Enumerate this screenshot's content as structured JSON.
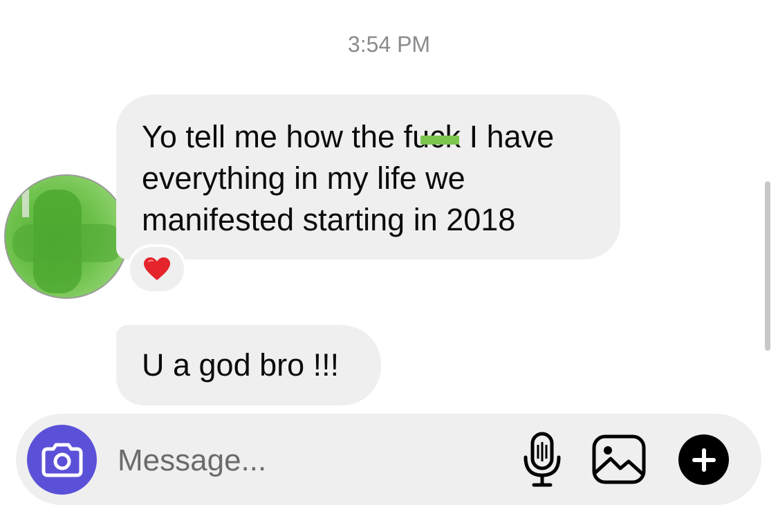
{
  "conversation": {
    "timestamp": "3:54 PM",
    "messages": [
      {
        "sender": "contact",
        "text_lines": [
          {
            "before": "Yo tell me how the ",
            "censored": "fuck",
            "after": " I have"
          },
          {
            "text": "everything in my life we"
          },
          {
            "text": "manifested starting in 2018"
          }
        ],
        "reaction": {
          "emoji": "heart",
          "color": "#e5242b"
        }
      },
      {
        "sender": "contact",
        "text": "U a god bro !!!"
      }
    ]
  },
  "composer": {
    "placeholder": "Message...",
    "camera_icon": "camera-icon",
    "mic_icon": "microphone-icon",
    "image_icon": "image-icon",
    "plus_icon": "plus-icon"
  },
  "colors": {
    "camera_button": "#5b51d8",
    "bubble": "#efefef",
    "censor_bar": "#7cc64f"
  }
}
